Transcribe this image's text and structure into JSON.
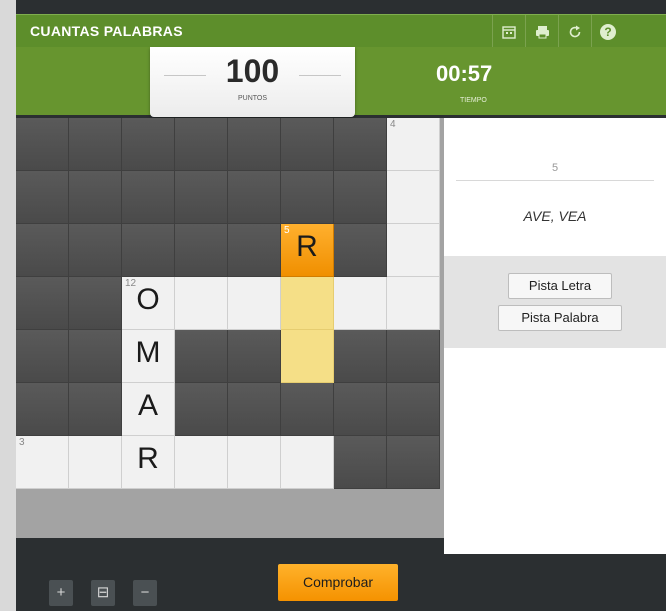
{
  "app": {
    "title": "CUANTAS PALABRAS"
  },
  "toolbar": {
    "icons": [
      "calendar-icon",
      "print-icon",
      "restart-icon",
      "help-icon"
    ],
    "help_glyph": "?"
  },
  "score": {
    "value": "100",
    "label": "PUNTOS"
  },
  "timer": {
    "value": "00:57",
    "label": "TIEMPO"
  },
  "grid": {
    "rows": 7,
    "cols": 8,
    "cells": [
      [
        "dark",
        "dark",
        "dark",
        "dark",
        "dark",
        "dark",
        "dark",
        "light"
      ],
      [
        "dark",
        "dark",
        "dark",
        "dark",
        "dark",
        "dark",
        "dark",
        "light"
      ],
      [
        "dark",
        "dark",
        "dark",
        "dark",
        "dark",
        "active",
        "dark",
        "light"
      ],
      [
        "dark",
        "dark",
        "light",
        "light",
        "light",
        "hl",
        "light",
        "light"
      ],
      [
        "dark",
        "dark",
        "light",
        "dark",
        "dark",
        "hl",
        "dark",
        "dark"
      ],
      [
        "dark",
        "dark",
        "light",
        "dark",
        "dark",
        "dark",
        "dark",
        "dark"
      ],
      [
        "light",
        "light",
        "light",
        "light",
        "light",
        "light",
        "dark",
        "dark"
      ]
    ],
    "letters": [
      {
        "r": 2,
        "c": 5,
        "ch": "R"
      },
      {
        "r": 3,
        "c": 2,
        "ch": "O"
      },
      {
        "r": 4,
        "c": 2,
        "ch": "M"
      },
      {
        "r": 5,
        "c": 2,
        "ch": "A"
      },
      {
        "r": 6,
        "c": 2,
        "ch": "R"
      }
    ],
    "numbers": [
      {
        "r": 0,
        "c": 7,
        "n": "4"
      },
      {
        "r": 2,
        "c": 5,
        "n": "5"
      },
      {
        "r": 3,
        "c": 2,
        "n": "12"
      },
      {
        "r": 6,
        "c": 0,
        "n": "3"
      }
    ]
  },
  "clue": {
    "number": "5",
    "text": "AVE, VEA"
  },
  "hints": {
    "letter_label": "Pista Letra",
    "word_label": "Pista Palabra"
  },
  "footer": {
    "zoom_in": "+",
    "zoom_reset": "⊟",
    "zoom_out": "−",
    "check_label": "Comprobar"
  },
  "colors": {
    "brand": "#5d8e2b",
    "accent": "#f59200",
    "highlight": "#f5df87"
  }
}
